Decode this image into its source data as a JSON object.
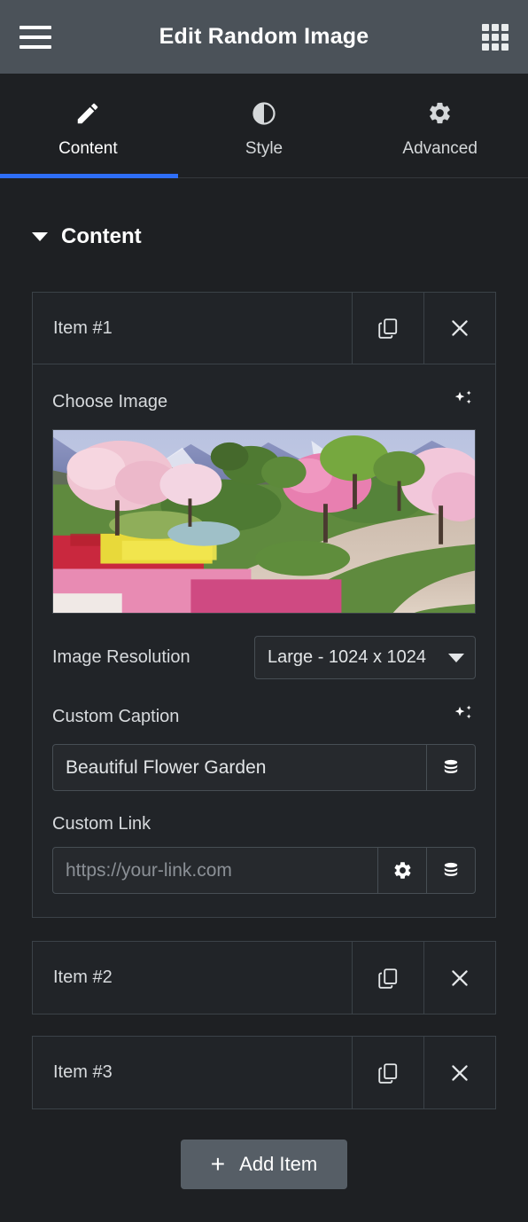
{
  "header": {
    "title": "Edit Random Image",
    "menu_icon": "hamburger-menu-icon",
    "apps_icon": "apps-grid-icon"
  },
  "tabs": [
    {
      "label": "Content",
      "icon": "pencil-icon",
      "active": true
    },
    {
      "label": "Style",
      "icon": "contrast-circle-icon",
      "active": false
    },
    {
      "label": "Advanced",
      "icon": "gear-icon",
      "active": false
    }
  ],
  "accent_color": "#2e6ef7",
  "section": {
    "title": "Content",
    "caret_icon": "caret-down-icon",
    "expanded": true
  },
  "items": [
    {
      "title": "Item #1",
      "duplicate_icon": "duplicate-icon",
      "remove_icon": "close-icon",
      "expanded": true,
      "fields": {
        "choose_image_label": "Choose Image",
        "choose_image_ai_icon": "ai-sparkle-icon",
        "image_alt": "Spring garden with cherry blossom trees, tulip beds and mountains",
        "resolution_label": "Image Resolution",
        "resolution_value": "Large - 1024 x 1024",
        "resolution_chevron_icon": "chevron-down-icon",
        "caption_label": "Custom Caption",
        "caption_ai_icon": "ai-sparkle-icon",
        "caption_value": "Beautiful Flower Garden",
        "caption_placeholder": "",
        "caption_dynamic_icon": "database-icon",
        "link_label": "Custom Link",
        "link_value": "",
        "link_placeholder": "https://your-link.com",
        "link_settings_icon": "gear-icon",
        "link_dynamic_icon": "database-icon"
      }
    },
    {
      "title": "Item #2",
      "duplicate_icon": "duplicate-icon",
      "remove_icon": "close-icon",
      "expanded": false
    },
    {
      "title": "Item #3",
      "duplicate_icon": "duplicate-icon",
      "remove_icon": "close-icon",
      "expanded": false
    }
  ],
  "add_item": {
    "label": "Add Item",
    "plus": "+"
  }
}
